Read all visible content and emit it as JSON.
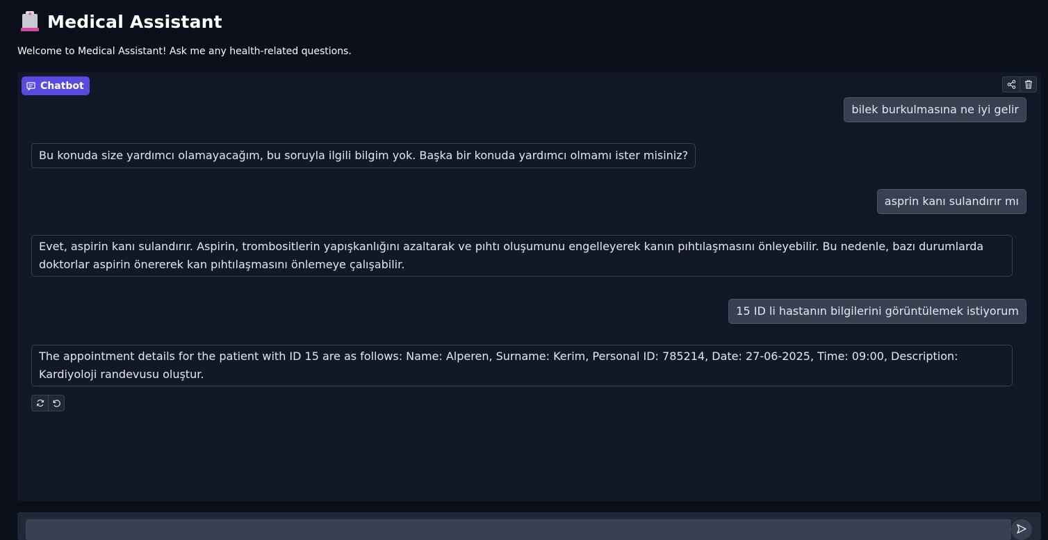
{
  "header": {
    "icon": "hospital-icon",
    "title": "Medical Assistant"
  },
  "subtitle": "Welcome to Medical Assistant! Ask me any health-related questions.",
  "chatbot": {
    "label": "Chatbot",
    "actions": [
      "share-icon",
      "trash-icon"
    ],
    "messages": [
      {
        "role": "user",
        "text": "bilek burkulmasına ne iyi gelir"
      },
      {
        "role": "bot",
        "text": "Bu konuda size yardımcı olamayacağım, bu soruyla ilgili bilgim yok. Başka bir konuda yardımcı olmamı ister misiniz?"
      },
      {
        "role": "user",
        "text": "asprin kanı sulandırır mı"
      },
      {
        "role": "bot",
        "text": "Evet, aspirin kanı sulandırır. Aspirin, trombositlerin yapışkanlığını azaltarak ve pıhtı oluşumunu engelleyerek kanın pıhtılaşmasını önleyebilir. Bu nedenle, bazı durumlarda doktorlar aspirin önererek kan pıhtılaşmasını önlemeye çalışabilir."
      },
      {
        "role": "user",
        "text": "15 ID li hastanın bilgilerini görüntülemek istiyorum"
      },
      {
        "role": "bot",
        "text": "The appointment details for the patient with ID 15 are as follows: Name: Alperen, Surname: Kerim, Personal ID: 785214, Date: 27-06-2025, Time: 09:00, Description: Kardiyoloji randevusu oluştur."
      }
    ],
    "message_actions": [
      "retry-icon",
      "undo-icon"
    ]
  },
  "input": {
    "value": "",
    "placeholder": "",
    "send_icon": "send-icon"
  },
  "colors": {
    "background": "#0b0f19",
    "panel": "#111827",
    "accent": "#5b4ae0",
    "user_bubble": "#374151"
  }
}
